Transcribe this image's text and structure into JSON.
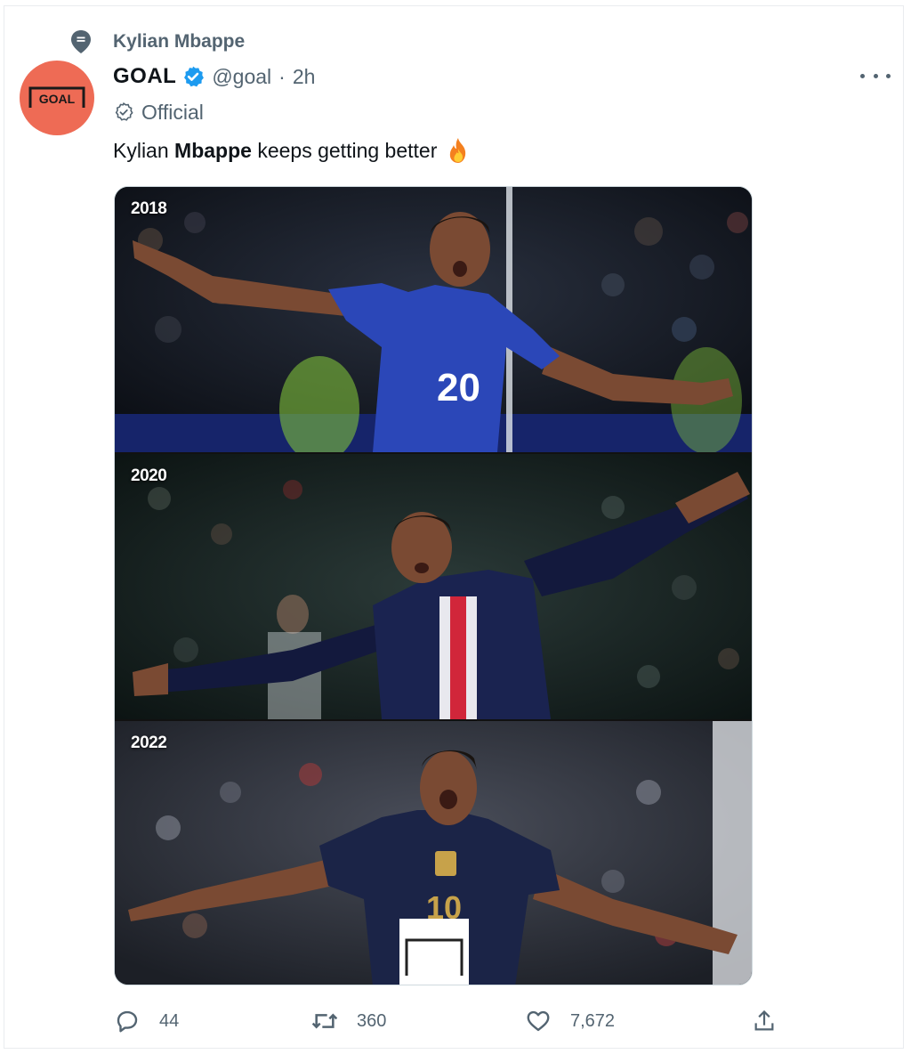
{
  "topic": {
    "label": "Kylian Mbappe",
    "icon": "topic-icon"
  },
  "author": {
    "display_name": "GOAL",
    "handle": "@goal",
    "separator": "·",
    "time": "2h",
    "avatar_text": "GOAL",
    "verified_icon": "verified-badge-icon",
    "avatar_color": "#ee6b55"
  },
  "label": {
    "text": "Official",
    "icon": "official-label-icon"
  },
  "tweet": {
    "text_before": "Kylian ",
    "text_bold": "Mbappe",
    "text_after": " keeps getting better",
    "emoji": "fire-emoji"
  },
  "media": {
    "panels": [
      {
        "year": "2018",
        "jersey_number": "20",
        "jersey_color": "#2b47b8"
      },
      {
        "year": "2020",
        "jersey_number": "",
        "jersey_color": "#1a2350"
      },
      {
        "year": "2022",
        "jersey_number": "10",
        "jersey_color": "#1b2447"
      }
    ]
  },
  "actions": {
    "reply_count": "44",
    "retweet_count": "360",
    "like_count": "7,672",
    "reply_icon": "reply-icon",
    "retweet_icon": "retweet-icon",
    "like_icon": "heart-icon",
    "share_icon": "share-icon"
  },
  "colors": {
    "muted": "#536471",
    "text": "#0f1419",
    "verified": "#1d9bf0"
  }
}
